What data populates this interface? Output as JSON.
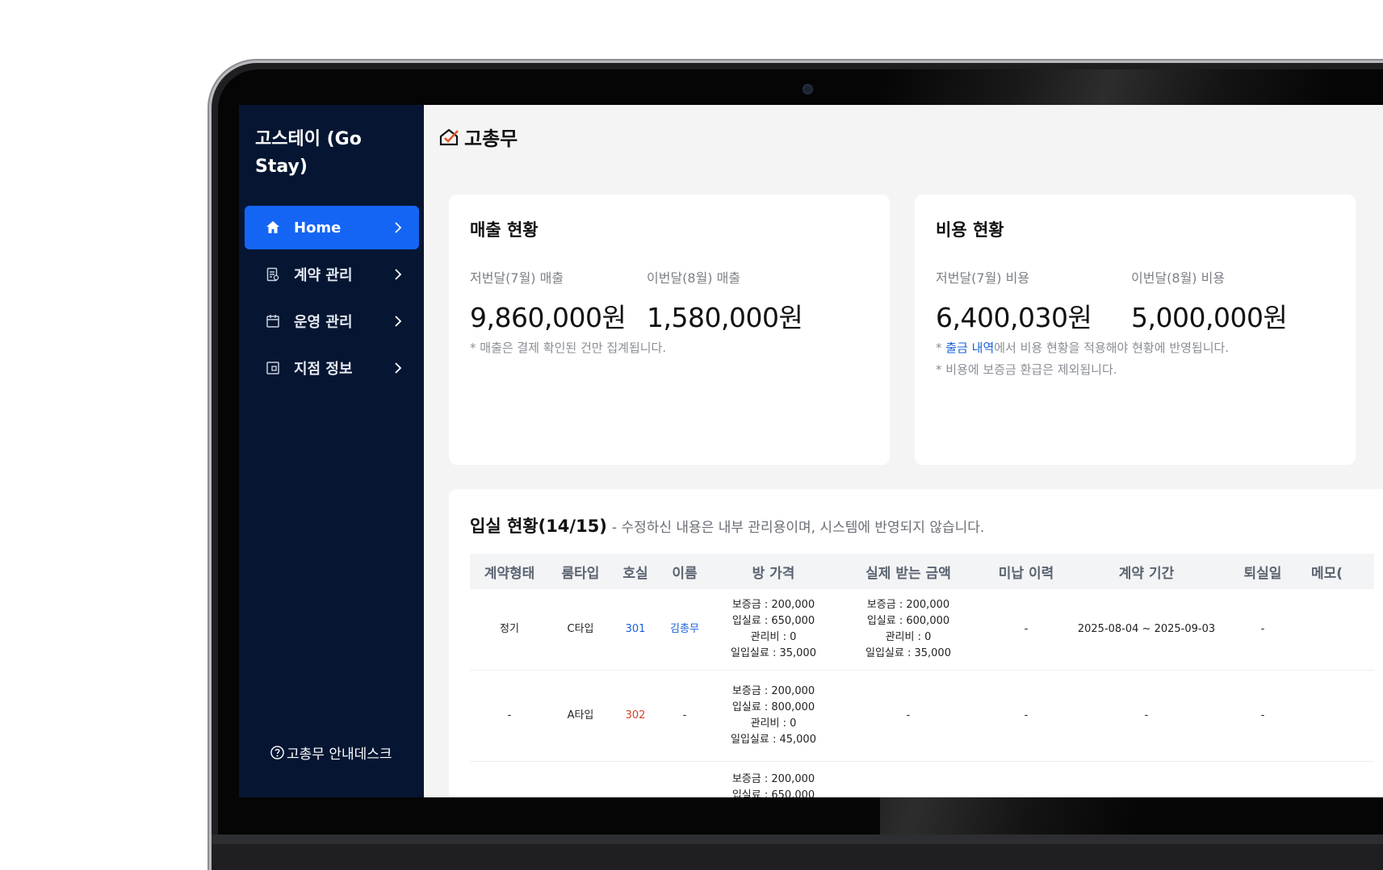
{
  "app": {
    "brand": "고스테이 (Go Stay)",
    "logo_text": "고총무",
    "helpdesk": "고총무 안내데스크"
  },
  "sidebar": {
    "items": [
      {
        "label": "Home",
        "icon": "home-icon",
        "active": true
      },
      {
        "label": "계약 관리",
        "icon": "contract-icon",
        "active": false
      },
      {
        "label": "운영 관리",
        "icon": "calendar-icon",
        "active": false
      },
      {
        "label": "지점 정보",
        "icon": "branch-icon",
        "active": false
      }
    ]
  },
  "sales": {
    "title": "매출 현황",
    "last_label": "저번달(7월) 매출",
    "last_value": "9,860,000원",
    "this_label": "이번달(8월) 매출",
    "this_value": "1,580,000원",
    "note": "* 매출은 결제 확인된 건만 집계됩니다."
  },
  "cost": {
    "title": "비용 현황",
    "last_label": "저번달(7월) 비용",
    "last_value": "6,400,030원",
    "this_label": "이번달(8월) 비용",
    "this_value": "5,000,000원",
    "note1_prefix": "* ",
    "note1_link": "출금 내역",
    "note1_suffix": "에서 비용 현황을 적용해야 현황에 반영됩니다.",
    "note2": "* 비용에 보증금 환급은 제외됩니다."
  },
  "occupancy": {
    "title": "입실 현황(14/15)",
    "subtitle": "- 수정하신 내용은 내부 관리용이며, 시스템에 반영되지 않습니다.",
    "headers": [
      "계약형태",
      "룸타입",
      "호실",
      "이름",
      "방 가격",
      "실제 받는 금액",
      "미납 이력",
      "계약 기간",
      "퇴실일",
      "메모("
    ],
    "rows": [
      {
        "contract": "정기",
        "room_type": "C타입",
        "room": "301",
        "name": "김총무",
        "price": [
          "보증금 : 200,000",
          "입실료 : 650,000",
          "관리비 : 0",
          "일입실료 : 35,000"
        ],
        "actual": [
          "보증금 : 200,000",
          "입실료 : 600,000",
          "관리비 : 0",
          "일입실료 : 35,000"
        ],
        "unpaid": "-",
        "period": "2025-08-04 ~ 2025-09-03",
        "checkout": "-"
      },
      {
        "contract": "-",
        "room_type": "A타입",
        "room": "302",
        "name": "-",
        "price": [
          "보증금 : 200,000",
          "입실료 : 800,000",
          "관리비 : 0",
          "일입실료 : 45,000"
        ],
        "actual_dash": "-",
        "unpaid": "-",
        "period": "-",
        "checkout": "-"
      },
      {
        "price": [
          "보증금 : 200,000",
          "입실료 : 650,000"
        ]
      }
    ]
  }
}
